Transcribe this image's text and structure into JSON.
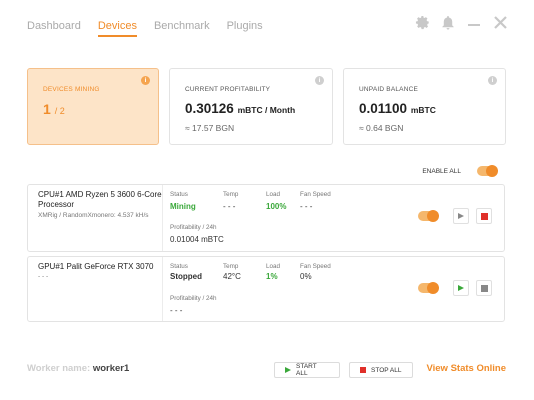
{
  "nav": {
    "items": [
      {
        "label": "Dashboard"
      },
      {
        "label": "Devices"
      },
      {
        "label": "Benchmark"
      },
      {
        "label": "Plugins"
      }
    ],
    "active": "Devices"
  },
  "window_icons": [
    "gear-icon",
    "bell-icon",
    "minimize-icon",
    "close-icon"
  ],
  "cards": {
    "mining": {
      "label": "DEVICES MINING",
      "value": "1",
      "total": "/ 2"
    },
    "profit": {
      "label": "CURRENT PROFITABILITY",
      "value": "0.30126",
      "unit": "mBTC / Month",
      "sub": "≈ 17.57 BGN"
    },
    "balance": {
      "label": "UNPAID BALANCE",
      "value": "0.01100",
      "unit": "mBTC",
      "sub": "≈ 0.64 BGN"
    }
  },
  "enable_all": {
    "label": "ENABLE ALL",
    "enabled": true
  },
  "headers": {
    "status": "Status",
    "temp": "Temp",
    "load": "Load",
    "fan": "Fan Speed",
    "profit": "Profitability / 24h"
  },
  "devices": [
    {
      "name": "CPU#1 AMD Ryzen 5 3600 6-Core Processor",
      "sub": "XMRig / RandomXmonero: 4.537 kH/s",
      "status": "Mining",
      "temp": "- - -",
      "load": "100%",
      "fan": "- - -",
      "profit": "0.01004 mBTC",
      "enabled": true
    },
    {
      "name": "GPU#1 Palit GeForce RTX 3070",
      "sub": "- - -",
      "status": "Stopped",
      "temp": "42°C",
      "load": "1%",
      "fan": "0%",
      "profit": "- - -",
      "enabled": true
    }
  ],
  "footer": {
    "worker_label": "Worker name:",
    "worker_name": "worker1",
    "start_all": "START ALL",
    "stop_all": "STOP ALL",
    "view_stats": "View Stats Online"
  },
  "colors": {
    "accent": "#f08c2a",
    "green": "#3aa83a",
    "red": "#e0302a"
  }
}
